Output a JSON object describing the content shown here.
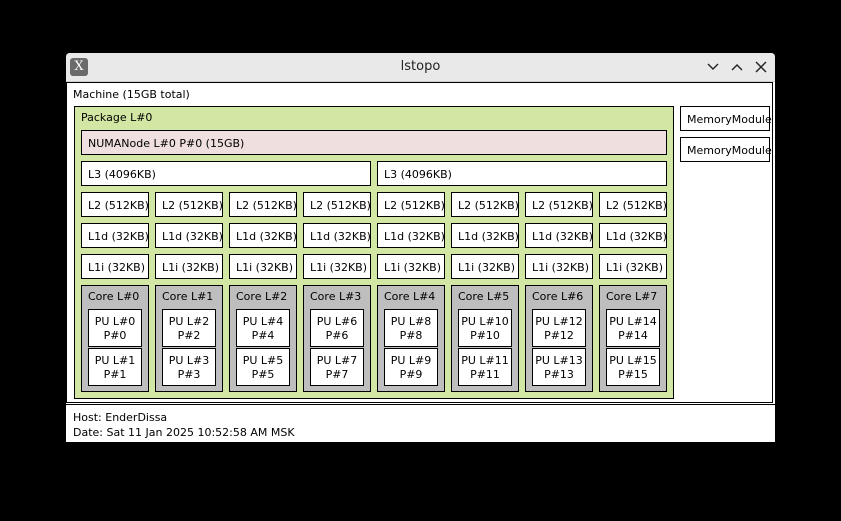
{
  "window": {
    "title": "lstopo"
  },
  "machine": {
    "label": "Machine (15GB total)",
    "package": {
      "label": "Package L#0"
    },
    "numa": {
      "label": "NUMANode L#0 P#0 (15GB)"
    },
    "l3": [
      "L3 (4096KB)",
      "L3 (4096KB)"
    ],
    "l2": [
      "L2 (512KB)",
      "L2 (512KB)",
      "L2 (512KB)",
      "L2 (512KB)",
      "L2 (512KB)",
      "L2 (512KB)",
      "L2 (512KB)",
      "L2 (512KB)"
    ],
    "l1d": [
      "L1d (32KB)",
      "L1d (32KB)",
      "L1d (32KB)",
      "L1d (32KB)",
      "L1d (32KB)",
      "L1d (32KB)",
      "L1d (32KB)",
      "L1d (32KB)"
    ],
    "l1i": [
      "L1i (32KB)",
      "L1i (32KB)",
      "L1i (32KB)",
      "L1i (32KB)",
      "L1i (32KB)",
      "L1i (32KB)",
      "L1i (32KB)",
      "L1i (32KB)"
    ],
    "cores": [
      {
        "label": "Core L#0",
        "pus": [
          {
            "l": "PU L#0",
            "p": "P#0"
          },
          {
            "l": "PU L#1",
            "p": "P#1"
          }
        ]
      },
      {
        "label": "Core L#1",
        "pus": [
          {
            "l": "PU L#2",
            "p": "P#2"
          },
          {
            "l": "PU L#3",
            "p": "P#3"
          }
        ]
      },
      {
        "label": "Core L#2",
        "pus": [
          {
            "l": "PU L#4",
            "p": "P#4"
          },
          {
            "l": "PU L#5",
            "p": "P#5"
          }
        ]
      },
      {
        "label": "Core L#3",
        "pus": [
          {
            "l": "PU L#6",
            "p": "P#6"
          },
          {
            "l": "PU L#7",
            "p": "P#7"
          }
        ]
      },
      {
        "label": "Core L#4",
        "pus": [
          {
            "l": "PU L#8",
            "p": "P#8"
          },
          {
            "l": "PU L#9",
            "p": "P#9"
          }
        ]
      },
      {
        "label": "Core L#5",
        "pus": [
          {
            "l": "PU L#10",
            "p": "P#10"
          },
          {
            "l": "PU L#11",
            "p": "P#11"
          }
        ]
      },
      {
        "label": "Core L#6",
        "pus": [
          {
            "l": "PU L#12",
            "p": "P#12"
          },
          {
            "l": "PU L#13",
            "p": "P#13"
          }
        ]
      },
      {
        "label": "Core L#7",
        "pus": [
          {
            "l": "PU L#14",
            "p": "P#14"
          },
          {
            "l": "PU L#15",
            "p": "P#15"
          }
        ]
      }
    ],
    "memory_modules": [
      "MemoryModule",
      "MemoryModule"
    ]
  },
  "footer": {
    "host": "Host: EnderDissa",
    "date": "Date: Sat 11 Jan 2025 10:52:58 AM MSK"
  },
  "colors": {
    "package": "#d2e7a4",
    "numa": "#efdfde",
    "core": "#bebebe",
    "cache": "#ffffff"
  }
}
